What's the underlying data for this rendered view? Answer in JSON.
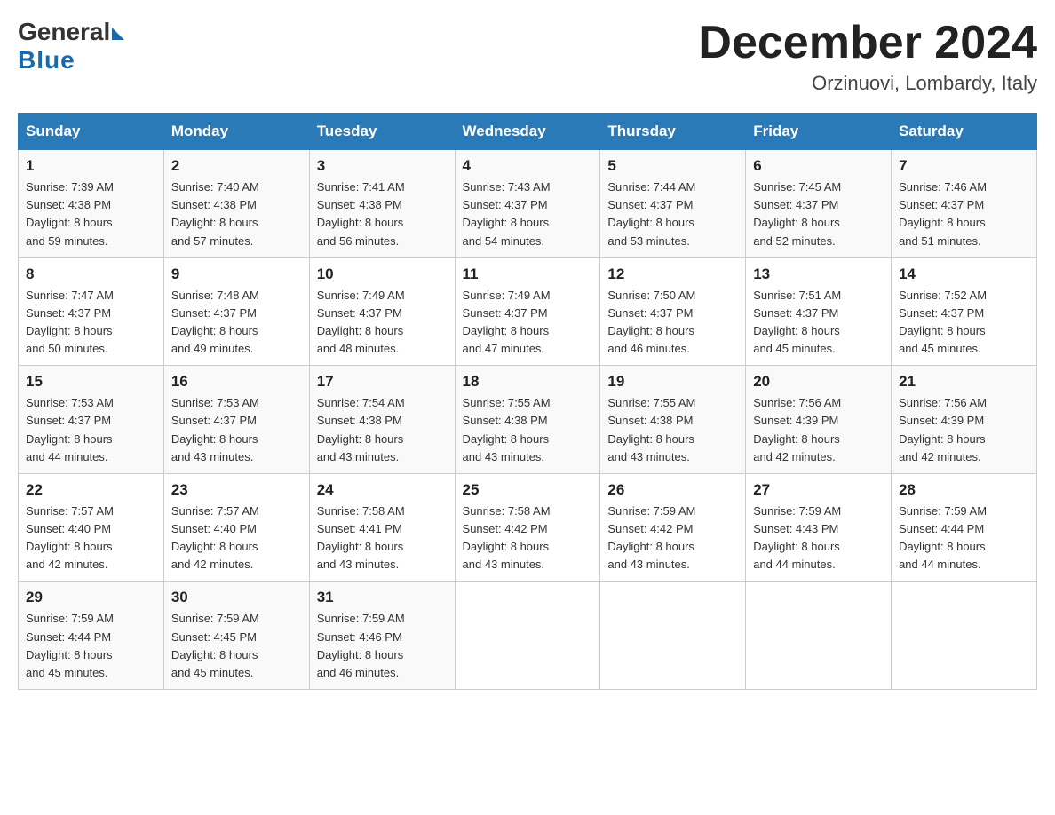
{
  "logo": {
    "general": "General",
    "blue": "Blue"
  },
  "header": {
    "title": "December 2024",
    "location": "Orzinuovi, Lombardy, Italy"
  },
  "days_of_week": [
    "Sunday",
    "Monday",
    "Tuesday",
    "Wednesday",
    "Thursday",
    "Friday",
    "Saturday"
  ],
  "weeks": [
    [
      {
        "day": "1",
        "sunrise": "7:39 AM",
        "sunset": "4:38 PM",
        "daylight": "8 hours and 59 minutes."
      },
      {
        "day": "2",
        "sunrise": "7:40 AM",
        "sunset": "4:38 PM",
        "daylight": "8 hours and 57 minutes."
      },
      {
        "day": "3",
        "sunrise": "7:41 AM",
        "sunset": "4:38 PM",
        "daylight": "8 hours and 56 minutes."
      },
      {
        "day": "4",
        "sunrise": "7:43 AM",
        "sunset": "4:37 PM",
        "daylight": "8 hours and 54 minutes."
      },
      {
        "day": "5",
        "sunrise": "7:44 AM",
        "sunset": "4:37 PM",
        "daylight": "8 hours and 53 minutes."
      },
      {
        "day": "6",
        "sunrise": "7:45 AM",
        "sunset": "4:37 PM",
        "daylight": "8 hours and 52 minutes."
      },
      {
        "day": "7",
        "sunrise": "7:46 AM",
        "sunset": "4:37 PM",
        "daylight": "8 hours and 51 minutes."
      }
    ],
    [
      {
        "day": "8",
        "sunrise": "7:47 AM",
        "sunset": "4:37 PM",
        "daylight": "8 hours and 50 minutes."
      },
      {
        "day": "9",
        "sunrise": "7:48 AM",
        "sunset": "4:37 PM",
        "daylight": "8 hours and 49 minutes."
      },
      {
        "day": "10",
        "sunrise": "7:49 AM",
        "sunset": "4:37 PM",
        "daylight": "8 hours and 48 minutes."
      },
      {
        "day": "11",
        "sunrise": "7:49 AM",
        "sunset": "4:37 PM",
        "daylight": "8 hours and 47 minutes."
      },
      {
        "day": "12",
        "sunrise": "7:50 AM",
        "sunset": "4:37 PM",
        "daylight": "8 hours and 46 minutes."
      },
      {
        "day": "13",
        "sunrise": "7:51 AM",
        "sunset": "4:37 PM",
        "daylight": "8 hours and 45 minutes."
      },
      {
        "day": "14",
        "sunrise": "7:52 AM",
        "sunset": "4:37 PM",
        "daylight": "8 hours and 45 minutes."
      }
    ],
    [
      {
        "day": "15",
        "sunrise": "7:53 AM",
        "sunset": "4:37 PM",
        "daylight": "8 hours and 44 minutes."
      },
      {
        "day": "16",
        "sunrise": "7:53 AM",
        "sunset": "4:37 PM",
        "daylight": "8 hours and 43 minutes."
      },
      {
        "day": "17",
        "sunrise": "7:54 AM",
        "sunset": "4:38 PM",
        "daylight": "8 hours and 43 minutes."
      },
      {
        "day": "18",
        "sunrise": "7:55 AM",
        "sunset": "4:38 PM",
        "daylight": "8 hours and 43 minutes."
      },
      {
        "day": "19",
        "sunrise": "7:55 AM",
        "sunset": "4:38 PM",
        "daylight": "8 hours and 43 minutes."
      },
      {
        "day": "20",
        "sunrise": "7:56 AM",
        "sunset": "4:39 PM",
        "daylight": "8 hours and 42 minutes."
      },
      {
        "day": "21",
        "sunrise": "7:56 AM",
        "sunset": "4:39 PM",
        "daylight": "8 hours and 42 minutes."
      }
    ],
    [
      {
        "day": "22",
        "sunrise": "7:57 AM",
        "sunset": "4:40 PM",
        "daylight": "8 hours and 42 minutes."
      },
      {
        "day": "23",
        "sunrise": "7:57 AM",
        "sunset": "4:40 PM",
        "daylight": "8 hours and 42 minutes."
      },
      {
        "day": "24",
        "sunrise": "7:58 AM",
        "sunset": "4:41 PM",
        "daylight": "8 hours and 43 minutes."
      },
      {
        "day": "25",
        "sunrise": "7:58 AM",
        "sunset": "4:42 PM",
        "daylight": "8 hours and 43 minutes."
      },
      {
        "day": "26",
        "sunrise": "7:59 AM",
        "sunset": "4:42 PM",
        "daylight": "8 hours and 43 minutes."
      },
      {
        "day": "27",
        "sunrise": "7:59 AM",
        "sunset": "4:43 PM",
        "daylight": "8 hours and 44 minutes."
      },
      {
        "day": "28",
        "sunrise": "7:59 AM",
        "sunset": "4:44 PM",
        "daylight": "8 hours and 44 minutes."
      }
    ],
    [
      {
        "day": "29",
        "sunrise": "7:59 AM",
        "sunset": "4:44 PM",
        "daylight": "8 hours and 45 minutes."
      },
      {
        "day": "30",
        "sunrise": "7:59 AM",
        "sunset": "4:45 PM",
        "daylight": "8 hours and 45 minutes."
      },
      {
        "day": "31",
        "sunrise": "7:59 AM",
        "sunset": "4:46 PM",
        "daylight": "8 hours and 46 minutes."
      },
      null,
      null,
      null,
      null
    ]
  ],
  "labels": {
    "sunrise": "Sunrise:",
    "sunset": "Sunset:",
    "daylight": "Daylight:"
  }
}
